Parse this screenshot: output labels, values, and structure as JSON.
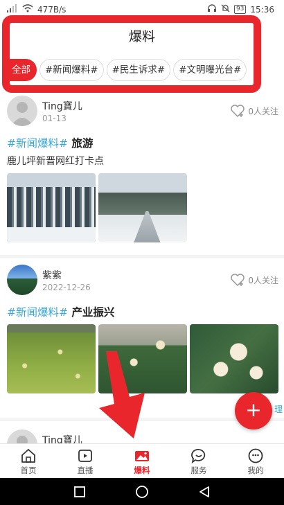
{
  "status_bar": {
    "network_speed": "477B/s",
    "battery": "93",
    "time": "15:36"
  },
  "header": {
    "title": "爆料"
  },
  "tabs": [
    {
      "label": "全部",
      "active": true
    },
    {
      "label": "#新闻爆料#",
      "active": false
    },
    {
      "label": "#民生诉求#",
      "active": false
    },
    {
      "label": "#文明曝光台#",
      "active": false
    }
  ],
  "posts": [
    {
      "user": "Ting寶儿",
      "date": "01-13",
      "follow": "0人关注",
      "tag": "#新闻爆料#",
      "topic": "旅游",
      "text": "鹿儿坪新晋网红打卡点",
      "images": [
        "snowy-forest",
        "snowy-road"
      ]
    },
    {
      "user": "紫紫",
      "date": "2022-12-26",
      "follow": "0人关注",
      "tag": "#新闻爆料#",
      "topic": "产业振兴",
      "images": [
        "flower-field",
        "loquat-blossom",
        "loquat-blossom-closeup"
      ]
    },
    {
      "user": "Ting寶儿"
    }
  ],
  "fab": {
    "label": "+",
    "partial_label_behind": "理"
  },
  "bottom_nav": [
    {
      "label": "首页",
      "icon": "home-icon",
      "active": false
    },
    {
      "label": "直播",
      "icon": "play-icon",
      "active": false
    },
    {
      "label": "爆料",
      "icon": "picture-icon",
      "active": true
    },
    {
      "label": "服务",
      "icon": "chat-icon",
      "active": false
    },
    {
      "label": "我的",
      "icon": "smile-icon",
      "active": false
    }
  ],
  "colors": {
    "accent": "#e8262c",
    "tag": "#38a6d8"
  }
}
